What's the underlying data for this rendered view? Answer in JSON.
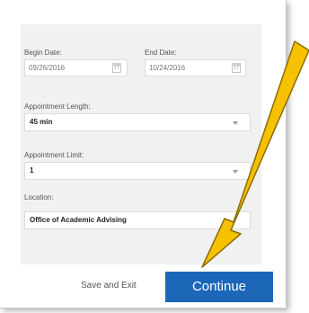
{
  "form": {
    "begin_date": {
      "label": "Begin Date:",
      "value": "09/26/2016"
    },
    "end_date": {
      "label": "End Date:",
      "value": "10/24/2016"
    },
    "appointment_length": {
      "label": "Appointment Length:",
      "value": "45 min"
    },
    "appointment_limit": {
      "label": "Appointment Limit:",
      "value": "1"
    },
    "location": {
      "label": "Location:",
      "value": "Office of Academic Advising"
    },
    "calendar_icon_glyph": "17"
  },
  "footer": {
    "save_exit_label": "Save and Exit",
    "continue_label": "Continue"
  },
  "annotation": {
    "arrow_color": "#f5c100",
    "arrow_outline_color": "#8a6d00"
  },
  "colors": {
    "continue_bg": "#1d67b8",
    "panel_bg": "#f1f1f1"
  }
}
